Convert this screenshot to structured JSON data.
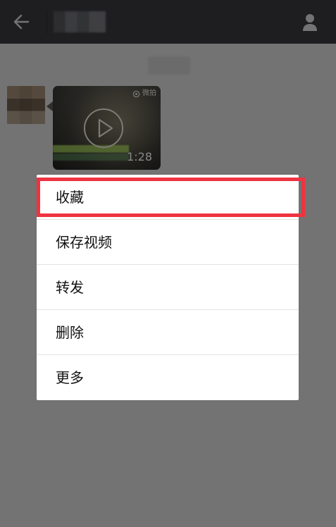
{
  "header": {
    "chat_title": "",
    "back_icon": "back-arrow-icon",
    "profile_icon": "person-icon"
  },
  "conversation": {
    "time_label": "",
    "message": {
      "type": "video",
      "brand": "微拍",
      "duration": "1:28",
      "subtitle": ""
    }
  },
  "context_menu": {
    "items": [
      {
        "label": "收藏"
      },
      {
        "label": "保存视频"
      },
      {
        "label": "转发"
      },
      {
        "label": "删除"
      },
      {
        "label": "更多"
      }
    ]
  },
  "annotation": {
    "highlight_color": "#ef3340"
  }
}
